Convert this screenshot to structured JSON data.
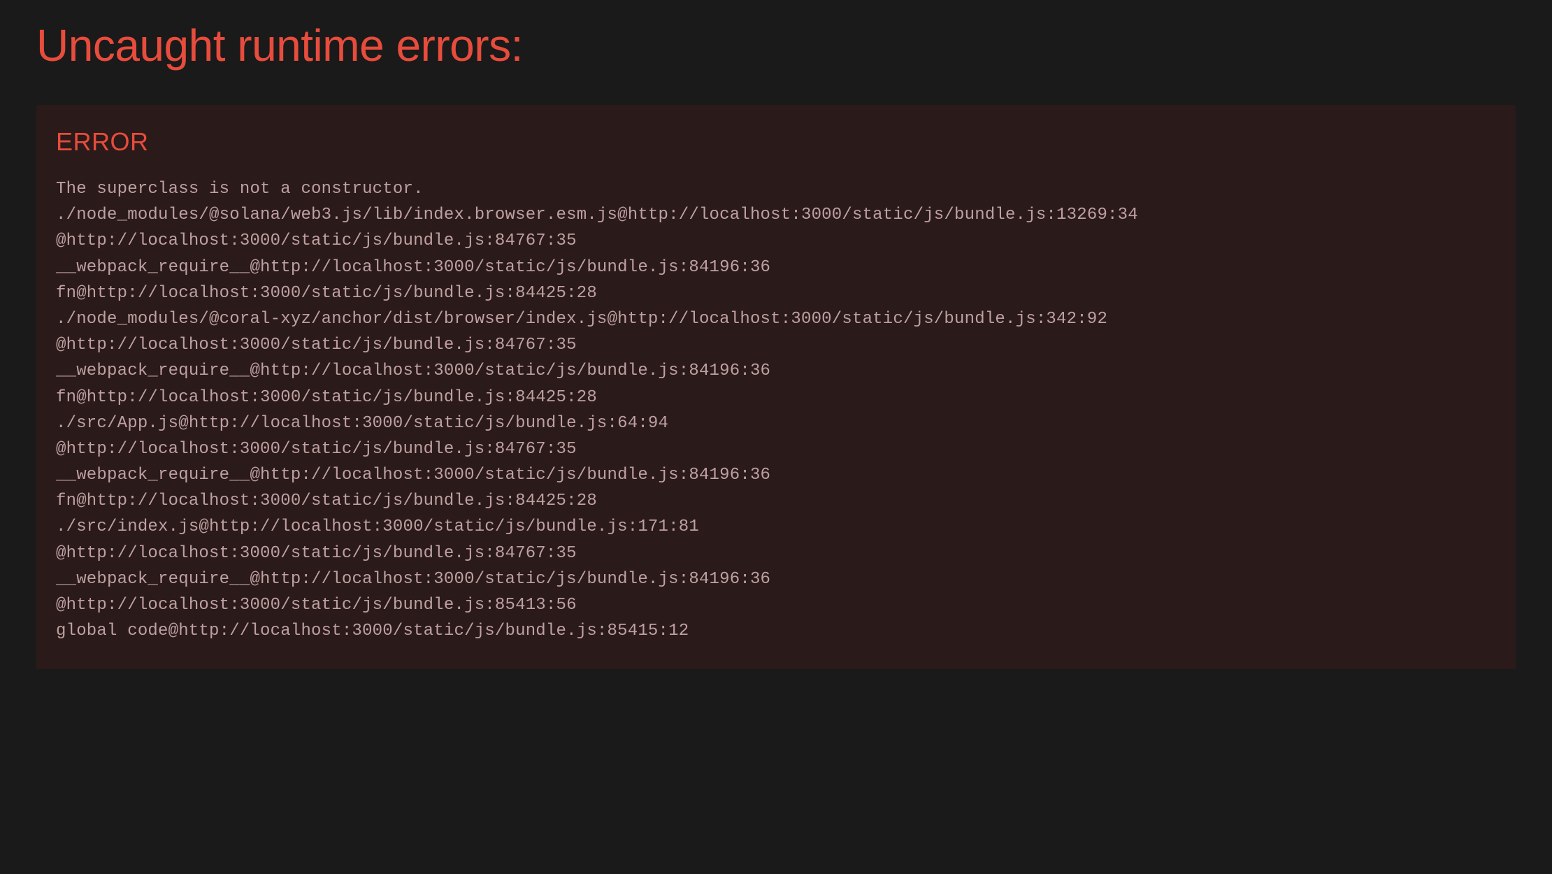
{
  "title": "Uncaught runtime errors:",
  "error": {
    "label": "ERROR",
    "message": "The superclass is not a constructor.",
    "stack": [
      "./node_modules/@solana/web3.js/lib/index.browser.esm.js@http://localhost:3000/static/js/bundle.js:13269:34",
      "@http://localhost:3000/static/js/bundle.js:84767:35",
      "__webpack_require__@http://localhost:3000/static/js/bundle.js:84196:36",
      "fn@http://localhost:3000/static/js/bundle.js:84425:28",
      "./node_modules/@coral-xyz/anchor/dist/browser/index.js@http://localhost:3000/static/js/bundle.js:342:92",
      "@http://localhost:3000/static/js/bundle.js:84767:35",
      "__webpack_require__@http://localhost:3000/static/js/bundle.js:84196:36",
      "fn@http://localhost:3000/static/js/bundle.js:84425:28",
      "./src/App.js@http://localhost:3000/static/js/bundle.js:64:94",
      "@http://localhost:3000/static/js/bundle.js:84767:35",
      "__webpack_require__@http://localhost:3000/static/js/bundle.js:84196:36",
      "fn@http://localhost:3000/static/js/bundle.js:84425:28",
      "./src/index.js@http://localhost:3000/static/js/bundle.js:171:81",
      "@http://localhost:3000/static/js/bundle.js:84767:35",
      "__webpack_require__@http://localhost:3000/static/js/bundle.js:84196:36",
      "@http://localhost:3000/static/js/bundle.js:85413:56",
      "global code@http://localhost:3000/static/js/bundle.js:85415:12"
    ]
  }
}
